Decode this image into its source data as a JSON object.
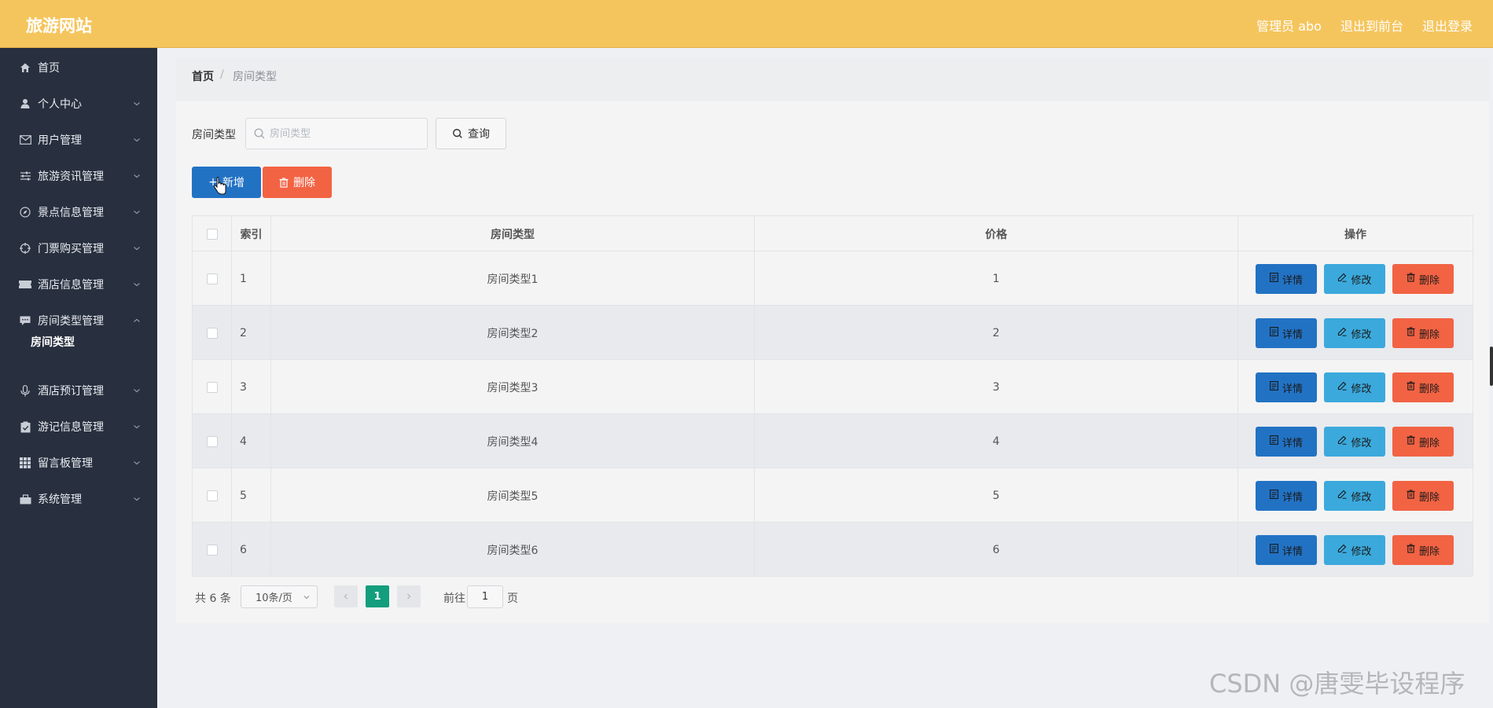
{
  "header": {
    "brand": "旅游网站",
    "admin_label": "管理员 abo",
    "front_label": "退出到前台",
    "logout_label": "退出登录"
  },
  "sidebar": {
    "items": [
      {
        "label": "首页",
        "icon": "home-icon"
      },
      {
        "label": "个人中心",
        "icon": "user-icon"
      },
      {
        "label": "用户管理",
        "icon": "mail-icon"
      },
      {
        "label": "旅游资讯管理",
        "icon": "sliders-icon"
      },
      {
        "label": "景点信息管理",
        "icon": "compass-icon"
      },
      {
        "label": "门票购买管理",
        "icon": "crosshair-icon"
      },
      {
        "label": "酒店信息管理",
        "icon": "ticket-icon"
      },
      {
        "label": "房间类型管理",
        "icon": "chat-icon"
      },
      {
        "label": "酒店预订管理",
        "icon": "microphone-icon"
      },
      {
        "label": "游记信息管理",
        "icon": "clipboard-icon"
      },
      {
        "label": "留言板管理",
        "icon": "grid-icon"
      },
      {
        "label": "系统管理",
        "icon": "briefcase-icon"
      }
    ],
    "sub_item": "房间类型"
  },
  "breadcrumb": {
    "home": "首页",
    "sep": "/",
    "current": "房间类型"
  },
  "search": {
    "label": "房间类型",
    "placeholder": "房间类型",
    "query_label": "查询"
  },
  "toolbar": {
    "add_label": "新增",
    "delete_label": "删除"
  },
  "table": {
    "columns": [
      "索引",
      "房间类型",
      "价格",
      "操作"
    ],
    "rows": [
      {
        "index": "1",
        "type": "房间类型1",
        "price": "1"
      },
      {
        "index": "2",
        "type": "房间类型2",
        "price": "2"
      },
      {
        "index": "3",
        "type": "房间类型3",
        "price": "3"
      },
      {
        "index": "4",
        "type": "房间类型4",
        "price": "4"
      },
      {
        "index": "5",
        "type": "房间类型5",
        "price": "5"
      },
      {
        "index": "6",
        "type": "房间类型6",
        "price": "6"
      }
    ],
    "actions": {
      "detail": "详情",
      "edit": "修改",
      "remove": "删除"
    }
  },
  "pagination": {
    "total": "共 6 条",
    "page_size": "10条/页",
    "current": "1",
    "goto_label": "前往",
    "goto_value": "1",
    "page_suffix": "页"
  },
  "watermark": "CSDN @唐雯毕设程序",
  "colors": {
    "header": "#f5c55d",
    "sidebar": "#28303f",
    "primary": "#2272c4",
    "info": "#3ba9dc",
    "danger": "#f26344",
    "pager": "#139e7e"
  }
}
